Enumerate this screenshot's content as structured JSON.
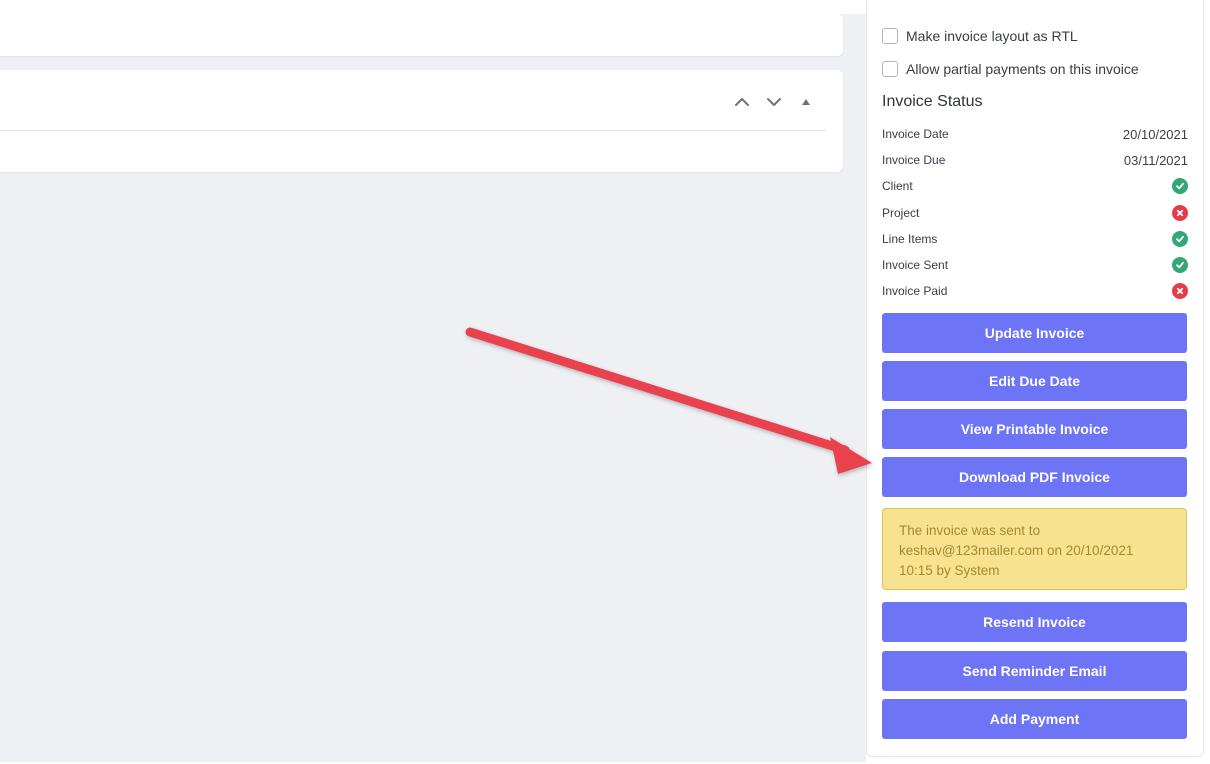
{
  "options": {
    "rtl_label": "Make invoice layout as RTL",
    "partial_label": "Allow partial payments on this invoice"
  },
  "status": {
    "title": "Invoice Status",
    "rows": [
      {
        "label": "Invoice Date",
        "value": "20/10/2021"
      },
      {
        "label": "Invoice Due",
        "value": "03/11/2021"
      },
      {
        "label": "Client",
        "state": "ok"
      },
      {
        "label": "Project",
        "state": "missing"
      },
      {
        "label": "Line Items",
        "state": "ok"
      },
      {
        "label": "Invoice Sent",
        "state": "ok"
      },
      {
        "label": "Invoice Paid",
        "state": "missing"
      }
    ]
  },
  "actions": {
    "update": "Update Invoice",
    "edit_due": "Edit Due Date",
    "view_printable": "View Printable Invoice",
    "download_pdf": "Download PDF Invoice",
    "resend": "Resend Invoice",
    "reminder": "Send Reminder Email",
    "add_payment": "Add Payment"
  },
  "notice": {
    "text": "The invoice was sent to keshav@123mailer.com on 20/10/2021 10:15 by System"
  },
  "colors": {
    "button": "#6d74f5",
    "ok": "#34a678",
    "missing": "#e53a4a",
    "notice_bg": "#f7e28f",
    "annotation_arrow": "#e8434f"
  },
  "icons": {
    "collapse": "chevron-up-icon",
    "expand": "chevron-down-icon",
    "toggle": "caret-up-icon",
    "ok": "check-circle-icon",
    "missing": "x-circle-icon"
  }
}
